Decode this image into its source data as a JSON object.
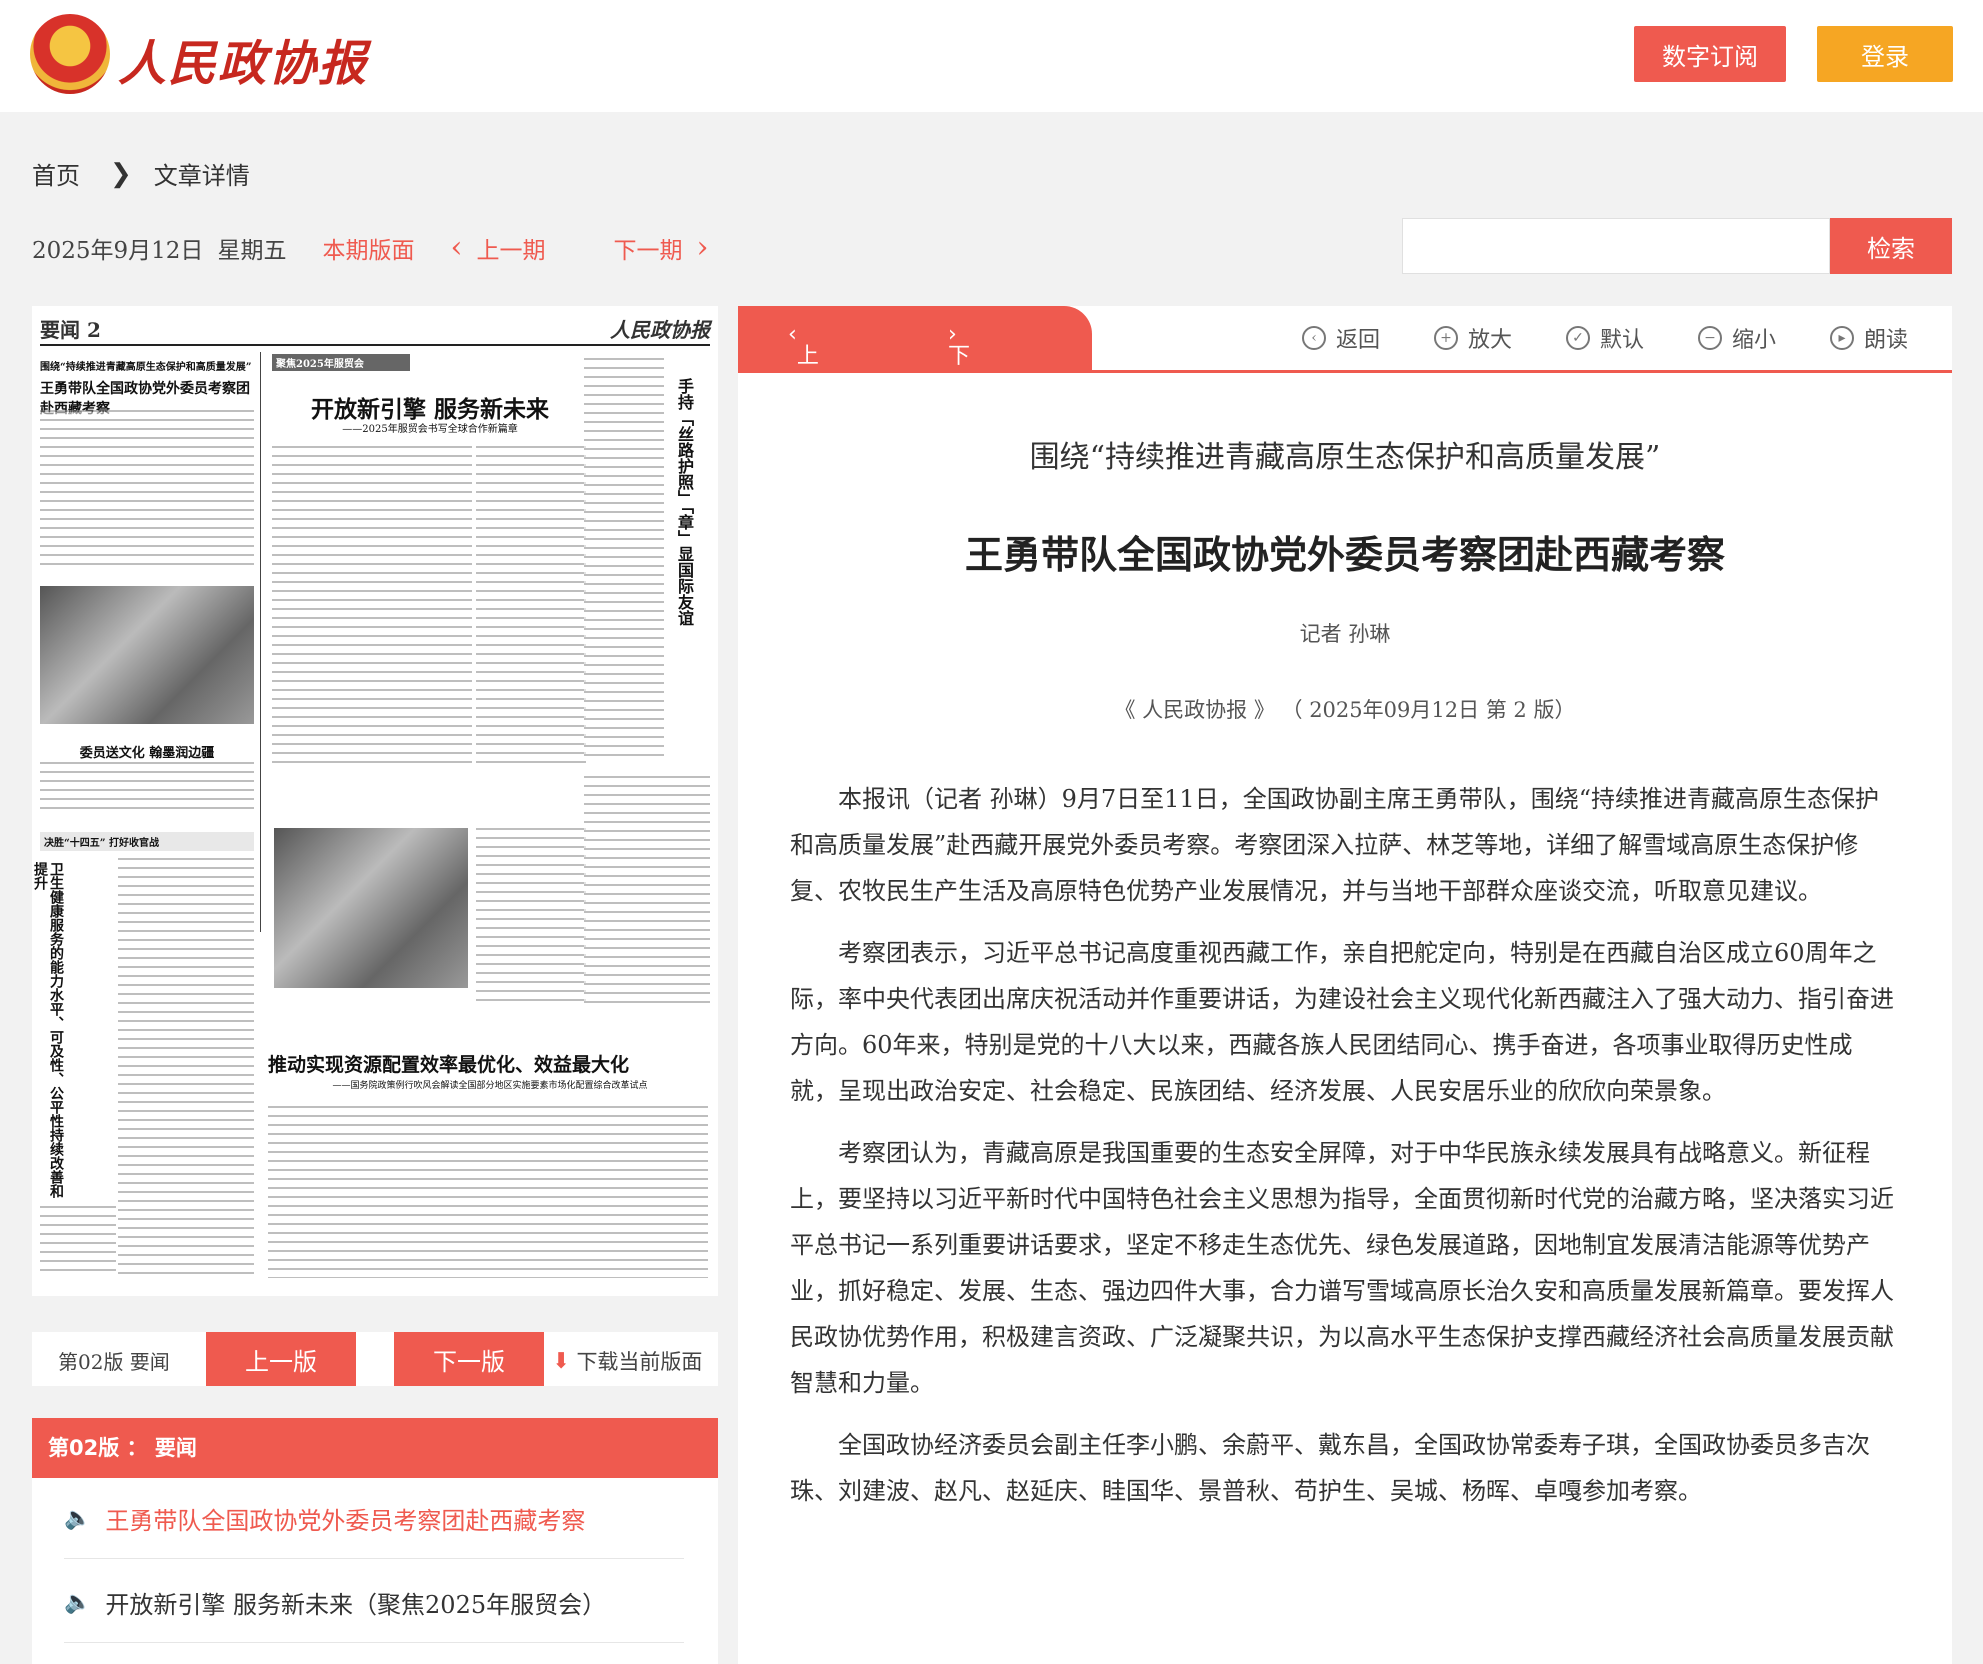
{
  "header": {
    "logo_text": "人民政协报",
    "subscribe_label": "数字订阅",
    "login_label": "登录"
  },
  "breadcrumb": {
    "home": "首页",
    "current": "文章详情"
  },
  "dateline": {
    "date": "2025年9月12日",
    "weekday": "星期五",
    "current_edition": "本期版面",
    "prev_issue": "上一期",
    "next_issue": "下一期"
  },
  "search": {
    "button_label": "检索",
    "placeholder": ""
  },
  "newspaper": {
    "page_label": "要闻 2",
    "masthead": "人民政协报",
    "headline_small": "围绕“持续推进青藏高原生态保护和高质量发展”",
    "headline_main": "王勇带队全国政协党外委员考察团赴西藏考察",
    "photo_caption": "委员送文化 翰墨润边疆",
    "section_tag": "聚焦2025年服贸会",
    "mid_title": "开放新引擎 服务新未来",
    "mid_subtitle": "——2025年服贸会书写全球合作新篇章",
    "right_title": "手持「丝路护照」「章」显国际友谊",
    "left_tag": "决胜“十四五” 打好收官战",
    "left_vertical_title": "卫生健康服务的能力水平、可及性、公平性持续改善和提升",
    "bottom_title": "推动实现资源配置效率最优化、效益最大化",
    "bottom_subtitle": "——国务院政策例行吹风会解读全国部分地区实施要素市场化配置综合改革试点"
  },
  "pagebar": {
    "page_label": "第02版  要闻",
    "prev_page": "上一版",
    "next_page": "下一版",
    "download": "下载当前版面"
  },
  "section_list": {
    "header": "第02版 ： 要闻",
    "items": [
      {
        "title": "王勇带队全国政协党外委员考察团赴西藏考察",
        "active": true
      },
      {
        "title": "开放新引擎 服务新未来（聚焦2025年服贸会）",
        "active": false
      }
    ]
  },
  "article_nav": {
    "prev": "上一篇",
    "next": "下一篇"
  },
  "tools": [
    {
      "label": "返回",
      "icon": "back-icon"
    },
    {
      "label": "放大",
      "icon": "zoom-in-icon"
    },
    {
      "label": "默认",
      "icon": "default-icon"
    },
    {
      "label": "缩小",
      "icon": "zoom-out-icon"
    },
    {
      "label": "朗读",
      "icon": "play-icon"
    }
  ],
  "article": {
    "subtitle": "围绕“持续推进青藏高原生态保护和高质量发展”",
    "title": "王勇带队全国政协党外委员考察团赴西藏考察",
    "author": "记者  孙琳",
    "source": "《 人民政协报 》 （ 2025年09月12日  第 2 版）",
    "paragraphs": [
      "本报讯（记者 孙琳）9月7日至11日，全国政协副主席王勇带队，围绕“持续推进青藏高原生态保护和高质量发展”赴西藏开展党外委员考察。考察团深入拉萨、林芝等地，详细了解雪域高原生态保护修复、农牧民生产生活及高原特色优势产业发展情况，并与当地干部群众座谈交流，听取意见建议。",
      "考察团表示，习近平总书记高度重视西藏工作，亲自把舵定向，特别是在西藏自治区成立60周年之际，率中央代表团出席庆祝活动并作重要讲话，为建设社会主义现代化新西藏注入了强大动力、指引奋进方向。60年来，特别是党的十八大以来，西藏各族人民团结同心、携手奋进，各项事业取得历史性成就，呈现出政治安定、社会稳定、民族团结、经济发展、人民安居乐业的欣欣向荣景象。",
      "考察团认为，青藏高原是我国重要的生态安全屏障，对于中华民族永续发展具有战略意义。新征程上，要坚持以习近平新时代中国特色社会主义思想为指导，全面贯彻新时代党的治藏方略，坚决落实习近平总书记一系列重要讲话要求，坚定不移走生态优先、绿色发展道路，因地制宜发展清洁能源等优势产业，抓好稳定、发展、生态、强边四件大事，合力谱写雪域高原长治久安和高质量发展新篇章。要发挥人民政协优势作用，积极建言资政、广泛凝聚共识，为以高水平生态保护支撑西藏经济社会高质量发展贡献智慧和力量。",
      "全国政协经济委员会副主任李小鹏、余蔚平、戴东昌，全国政协常委寿子琪，全国政协委员多吉次珠、刘建波、赵凡、赵延庆、眭国华、景普秋、苟护生、吴城、杨晖、卓嘎参加考察。"
    ]
  }
}
